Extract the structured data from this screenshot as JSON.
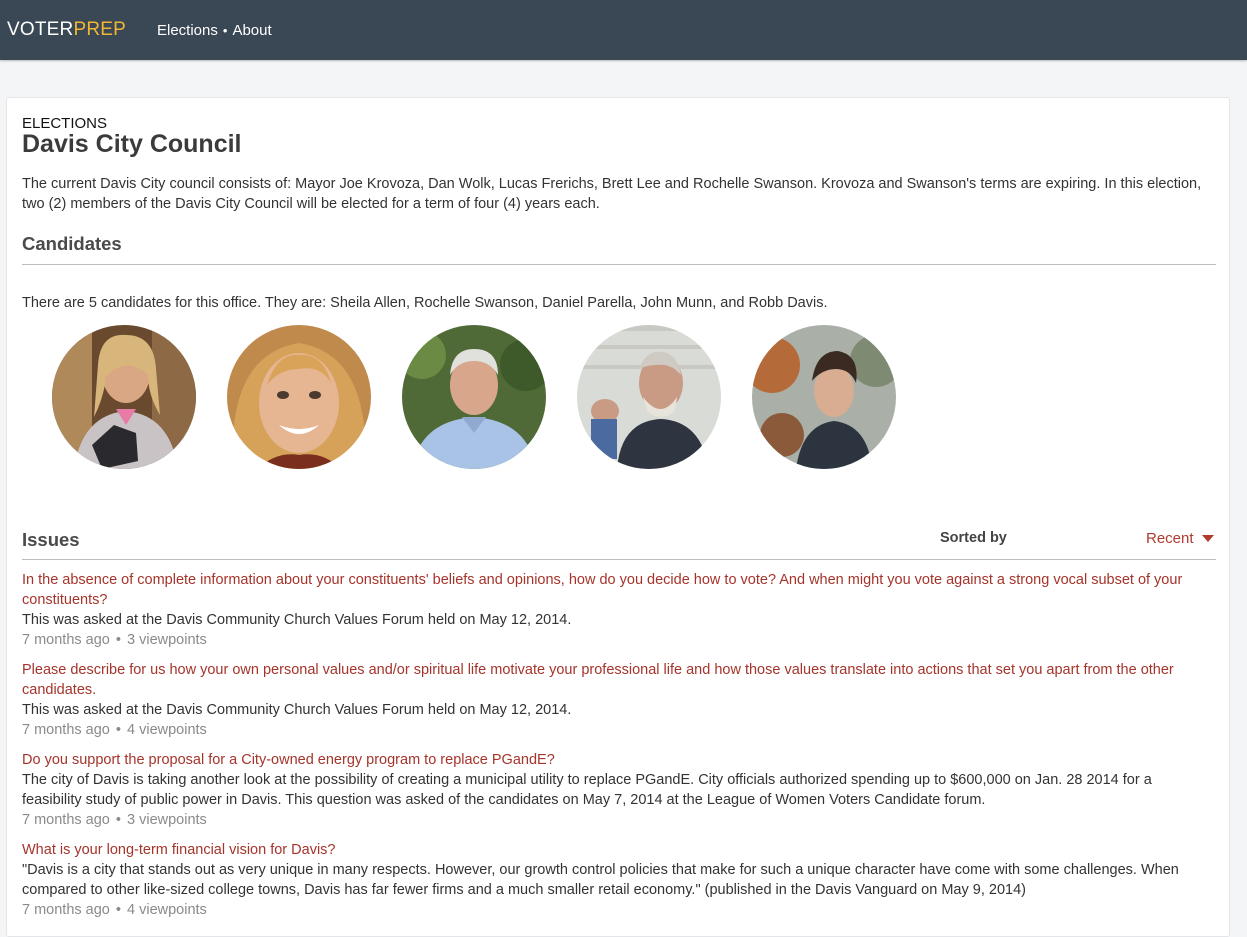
{
  "header": {
    "logo_part1": "VOTER",
    "logo_part2": "PREP",
    "nav": [
      "Elections",
      "About"
    ]
  },
  "page": {
    "breadcrumb": "ELECTIONS",
    "title": "Davis City Council",
    "description": "The current Davis City council consists of: Mayor Joe Krovoza, Dan Wolk, Lucas Frerichs, Brett Lee and Rochelle Swanson. Krovoza and Swanson's terms are expiring. In this election, two (2) members of the Davis City Council will be elected for a term of four (4) years each."
  },
  "candidates": {
    "heading": "Candidates",
    "summary": "There are 5 candidates for this office. They are: Sheila Allen, Rochelle Swanson, Daniel Parella, John Munn, and Robb Davis.",
    "people": [
      "Sheila Allen",
      "Rochelle Swanson",
      "Daniel Parella",
      "John Munn",
      "Robb Davis"
    ]
  },
  "issues": {
    "heading": "Issues",
    "sorted_by_label": "Sorted by",
    "sort_value": "Recent",
    "items": [
      {
        "question": "In the absence of complete information about your constituents' beliefs and opinions, how do you decide how to vote? And when might you vote against a strong vocal subset of your constituents?",
        "detail": "This was asked at the Davis Community Church Values Forum held on May 12, 2014.",
        "age": "7 months ago",
        "viewpoints": "3 viewpoints"
      },
      {
        "question": "Please describe for us how your own personal values and/or spiritual life motivate your professional life and how those values translate into actions that set you apart from the other candidates.",
        "detail": "This was asked at the Davis Community Church Values Forum held on May 12, 2014.",
        "age": "7 months ago",
        "viewpoints": "4 viewpoints"
      },
      {
        "question": "Do you support the proposal for a City-owned energy program to replace PGandE?",
        "detail": "The city of Davis is taking another look at the possibility of creating a municipal utility to replace PGandE. City officials authorized spending up to $600,000 on Jan. 28 2014 for a feasibility study of public power in Davis. This question was asked of the candidates on May 7, 2014 at the League of Women Voters Candidate forum.",
        "age": "7 months ago",
        "viewpoints": "3 viewpoints"
      },
      {
        "question": "What is your long-term financial vision for Davis?",
        "detail": "\"Davis is a city that stands out as very unique in many respects. However, our growth control policies that make for such a unique character have come with some challenges. When compared to other like-sized college towns, Davis has far fewer firms and a much smaller retail economy.\" (published in the Davis Vanguard on May 9, 2014)",
        "age": "7 months ago",
        "viewpoints": "4 viewpoints"
      }
    ]
  },
  "colors": {
    "topbar": "#3a4855",
    "logo_accent": "#f2b632",
    "link": "#a5342b"
  }
}
